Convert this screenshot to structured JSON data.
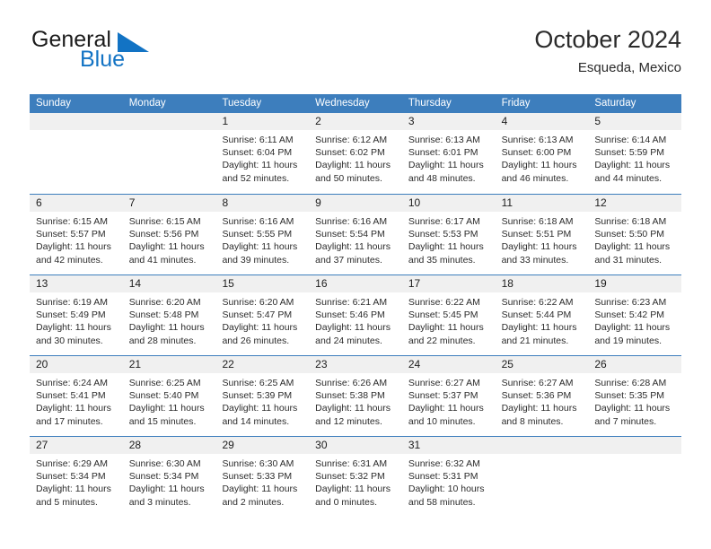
{
  "brand": {
    "name_top": "General",
    "name_bottom": "Blue",
    "triangle_color": "#1273c4",
    "top_color": "#1c1c1c"
  },
  "header": {
    "title": "October 2024",
    "subtitle": "Esqueda, Mexico",
    "accent_color": "#3d7ebd",
    "day_band_color": "#f0f0f0"
  },
  "weekdays": [
    "Sunday",
    "Monday",
    "Tuesday",
    "Wednesday",
    "Thursday",
    "Friday",
    "Saturday"
  ],
  "weeks": [
    [
      {
        "day": "",
        "lines": []
      },
      {
        "day": "",
        "lines": []
      },
      {
        "day": "1",
        "lines": [
          "Sunrise: 6:11 AM",
          "Sunset: 6:04 PM",
          "Daylight: 11 hours",
          "and 52 minutes."
        ]
      },
      {
        "day": "2",
        "lines": [
          "Sunrise: 6:12 AM",
          "Sunset: 6:02 PM",
          "Daylight: 11 hours",
          "and 50 minutes."
        ]
      },
      {
        "day": "3",
        "lines": [
          "Sunrise: 6:13 AM",
          "Sunset: 6:01 PM",
          "Daylight: 11 hours",
          "and 48 minutes."
        ]
      },
      {
        "day": "4",
        "lines": [
          "Sunrise: 6:13 AM",
          "Sunset: 6:00 PM",
          "Daylight: 11 hours",
          "and 46 minutes."
        ]
      },
      {
        "day": "5",
        "lines": [
          "Sunrise: 6:14 AM",
          "Sunset: 5:59 PM",
          "Daylight: 11 hours",
          "and 44 minutes."
        ]
      }
    ],
    [
      {
        "day": "6",
        "lines": [
          "Sunrise: 6:15 AM",
          "Sunset: 5:57 PM",
          "Daylight: 11 hours",
          "and 42 minutes."
        ]
      },
      {
        "day": "7",
        "lines": [
          "Sunrise: 6:15 AM",
          "Sunset: 5:56 PM",
          "Daylight: 11 hours",
          "and 41 minutes."
        ]
      },
      {
        "day": "8",
        "lines": [
          "Sunrise: 6:16 AM",
          "Sunset: 5:55 PM",
          "Daylight: 11 hours",
          "and 39 minutes."
        ]
      },
      {
        "day": "9",
        "lines": [
          "Sunrise: 6:16 AM",
          "Sunset: 5:54 PM",
          "Daylight: 11 hours",
          "and 37 minutes."
        ]
      },
      {
        "day": "10",
        "lines": [
          "Sunrise: 6:17 AM",
          "Sunset: 5:53 PM",
          "Daylight: 11 hours",
          "and 35 minutes."
        ]
      },
      {
        "day": "11",
        "lines": [
          "Sunrise: 6:18 AM",
          "Sunset: 5:51 PM",
          "Daylight: 11 hours",
          "and 33 minutes."
        ]
      },
      {
        "day": "12",
        "lines": [
          "Sunrise: 6:18 AM",
          "Sunset: 5:50 PM",
          "Daylight: 11 hours",
          "and 31 minutes."
        ]
      }
    ],
    [
      {
        "day": "13",
        "lines": [
          "Sunrise: 6:19 AM",
          "Sunset: 5:49 PM",
          "Daylight: 11 hours",
          "and 30 minutes."
        ]
      },
      {
        "day": "14",
        "lines": [
          "Sunrise: 6:20 AM",
          "Sunset: 5:48 PM",
          "Daylight: 11 hours",
          "and 28 minutes."
        ]
      },
      {
        "day": "15",
        "lines": [
          "Sunrise: 6:20 AM",
          "Sunset: 5:47 PM",
          "Daylight: 11 hours",
          "and 26 minutes."
        ]
      },
      {
        "day": "16",
        "lines": [
          "Sunrise: 6:21 AM",
          "Sunset: 5:46 PM",
          "Daylight: 11 hours",
          "and 24 minutes."
        ]
      },
      {
        "day": "17",
        "lines": [
          "Sunrise: 6:22 AM",
          "Sunset: 5:45 PM",
          "Daylight: 11 hours",
          "and 22 minutes."
        ]
      },
      {
        "day": "18",
        "lines": [
          "Sunrise: 6:22 AM",
          "Sunset: 5:44 PM",
          "Daylight: 11 hours",
          "and 21 minutes."
        ]
      },
      {
        "day": "19",
        "lines": [
          "Sunrise: 6:23 AM",
          "Sunset: 5:42 PM",
          "Daylight: 11 hours",
          "and 19 minutes."
        ]
      }
    ],
    [
      {
        "day": "20",
        "lines": [
          "Sunrise: 6:24 AM",
          "Sunset: 5:41 PM",
          "Daylight: 11 hours",
          "and 17 minutes."
        ]
      },
      {
        "day": "21",
        "lines": [
          "Sunrise: 6:25 AM",
          "Sunset: 5:40 PM",
          "Daylight: 11 hours",
          "and 15 minutes."
        ]
      },
      {
        "day": "22",
        "lines": [
          "Sunrise: 6:25 AM",
          "Sunset: 5:39 PM",
          "Daylight: 11 hours",
          "and 14 minutes."
        ]
      },
      {
        "day": "23",
        "lines": [
          "Sunrise: 6:26 AM",
          "Sunset: 5:38 PM",
          "Daylight: 11 hours",
          "and 12 minutes."
        ]
      },
      {
        "day": "24",
        "lines": [
          "Sunrise: 6:27 AM",
          "Sunset: 5:37 PM",
          "Daylight: 11 hours",
          "and 10 minutes."
        ]
      },
      {
        "day": "25",
        "lines": [
          "Sunrise: 6:27 AM",
          "Sunset: 5:36 PM",
          "Daylight: 11 hours",
          "and 8 minutes."
        ]
      },
      {
        "day": "26",
        "lines": [
          "Sunrise: 6:28 AM",
          "Sunset: 5:35 PM",
          "Daylight: 11 hours",
          "and 7 minutes."
        ]
      }
    ],
    [
      {
        "day": "27",
        "lines": [
          "Sunrise: 6:29 AM",
          "Sunset: 5:34 PM",
          "Daylight: 11 hours",
          "and 5 minutes."
        ]
      },
      {
        "day": "28",
        "lines": [
          "Sunrise: 6:30 AM",
          "Sunset: 5:34 PM",
          "Daylight: 11 hours",
          "and 3 minutes."
        ]
      },
      {
        "day": "29",
        "lines": [
          "Sunrise: 6:30 AM",
          "Sunset: 5:33 PM",
          "Daylight: 11 hours",
          "and 2 minutes."
        ]
      },
      {
        "day": "30",
        "lines": [
          "Sunrise: 6:31 AM",
          "Sunset: 5:32 PM",
          "Daylight: 11 hours",
          "and 0 minutes."
        ]
      },
      {
        "day": "31",
        "lines": [
          "Sunrise: 6:32 AM",
          "Sunset: 5:31 PM",
          "Daylight: 10 hours",
          "and 58 minutes."
        ]
      },
      {
        "day": "",
        "lines": []
      },
      {
        "day": "",
        "lines": []
      }
    ]
  ]
}
